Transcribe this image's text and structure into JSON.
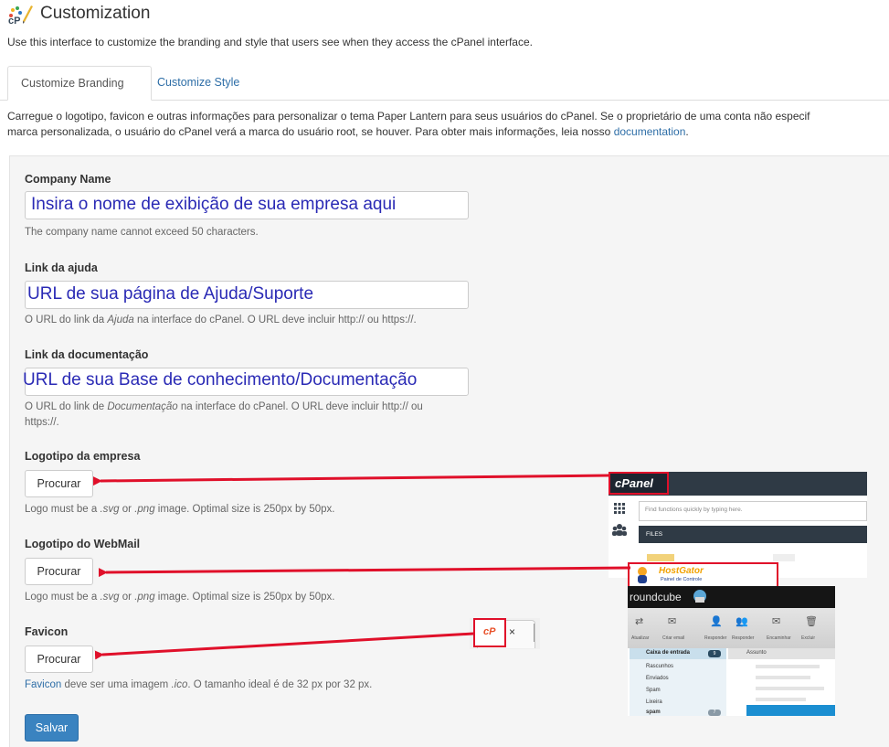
{
  "header": {
    "title": "Customization",
    "description": "Use this interface to customize the branding and style that users see when they access the cPanel interface."
  },
  "tabs": [
    {
      "label": "Customize Branding"
    },
    {
      "label": "Customize Style"
    }
  ],
  "tab_intro": {
    "line1": "Carregue o logotipo, favicon e outras informações para personalizar o tema Paper Lantern para seus usuários do cPanel. Se o proprietário de uma conta não especif",
    "line2_prefix": "marca personalizada, o usuário do cPanel verá a marca do usuário root, se houver. Para obter mais informações, leia nosso ",
    "line2_link": "documentation",
    "line2_suffix": "."
  },
  "form": {
    "company": {
      "label": "Company Name",
      "value": "Insira o nome de exibição de sua empresa aqui",
      "help": "The company name cannot exceed 50 characters."
    },
    "help_link": {
      "label": "Link da ajuda",
      "value": "URL de sua página de Ajuda/Suporte",
      "help_a": "O URL do link da ",
      "help_em": "Ajuda",
      "help_b": " na interface do cPanel. O URL deve incluir http:// ou https://."
    },
    "doc_link": {
      "label": "Link da documentação",
      "value": "URL de sua Base de conhecimento/Documentação",
      "help_a": "O URL do link de ",
      "help_em": "Documentação",
      "help_b": " na interface do cPanel. O URL deve incluir http:// ou",
      "help_c": "https://."
    },
    "logo": {
      "label": "Logotipo da empresa",
      "button": "Procurar",
      "help_a": "Logo must be a ",
      "help_em1": ".svg",
      "help_mid": " or ",
      "help_em2": ".png",
      "help_b": " image. Optimal size is 250px by 50px."
    },
    "webmail_logo": {
      "label": "Logotipo do WebMail",
      "button": "Procurar",
      "help_a": "Logo must be a ",
      "help_em1": ".svg",
      "help_mid": " or ",
      "help_em2": ".png",
      "help_b": " image. Optimal size is 250px by 50px."
    },
    "favicon": {
      "label": "Favicon",
      "button": "Procurar",
      "help_link": "Favicon",
      "help_a": " deve ser uma imagem ",
      "help_em": ".ico",
      "help_b": ". O tamanho ideal é de 32 px por 32 px."
    },
    "save_label": "Salvar"
  },
  "previews": {
    "cpanel": {
      "logo": "cPanel",
      "search_placeholder": "Find functions quickly by typing here.",
      "section": "FILES",
      "hostgator_name": "HostGator",
      "hostgator_sub": "Painel de Controle",
      "tions": "ions"
    },
    "roundcube": {
      "brand": "roundcube",
      "toolbar": [
        "Atualizar",
        "Criar email",
        "Responder",
        "Responder",
        "Encaminhar",
        "Excluir"
      ],
      "folders": [
        {
          "name": "Caixa de entrada",
          "count": "9"
        },
        {
          "name": "Rascunhos",
          "count": ""
        },
        {
          "name": "Enviados",
          "count": ""
        },
        {
          "name": "Spam",
          "count": ""
        },
        {
          "name": "Lixeira",
          "count": ""
        },
        {
          "name": "spam",
          "count": "7"
        }
      ],
      "subject_header": "Assunto"
    },
    "favicon_tab": {
      "icon": "cP",
      "close": "×"
    }
  },
  "colors": {
    "link": "#2e6ea7",
    "annotation_red": "#e0102a",
    "placeholder_blue": "#2a2ab5",
    "save_button": "#3a83c0"
  }
}
